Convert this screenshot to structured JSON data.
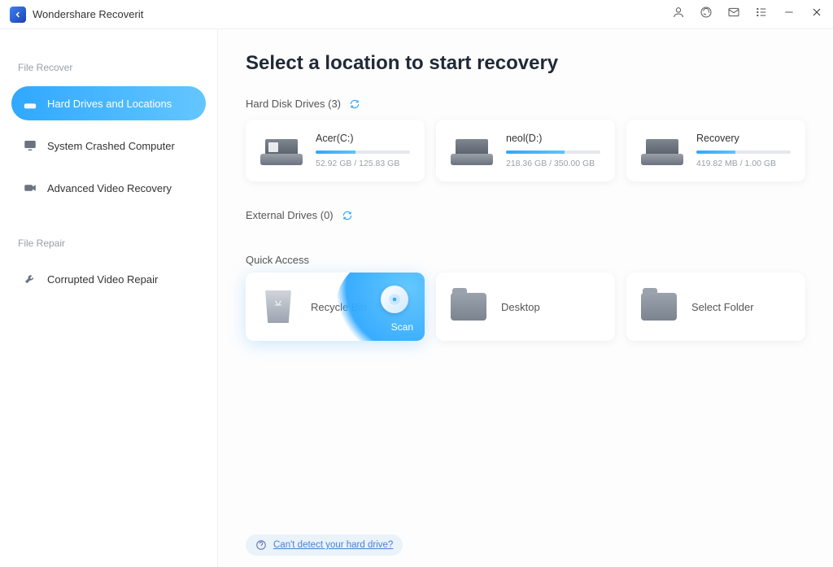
{
  "app": {
    "title": "Wondershare Recoverit"
  },
  "sidebar": {
    "sectionRecover": "File Recover",
    "sectionRepair": "File Repair",
    "items": {
      "drives": "Hard Drives and Locations",
      "crashed": "System Crashed Computer",
      "video": "Advanced Video Recovery",
      "repair": "Corrupted Video Repair"
    }
  },
  "main": {
    "title": "Select a location to start recovery",
    "hddHeader": "Hard Disk Drives (3)",
    "extHeader": "External Drives (0)",
    "quickHeader": "Quick Access"
  },
  "drives": [
    {
      "name": "Acer(C:)",
      "cap": "52.92 GB / 125.83 GB",
      "pct": 42,
      "win": true
    },
    {
      "name": "neol(D:)",
      "cap": "218.36 GB / 350.00 GB",
      "pct": 62,
      "win": false
    },
    {
      "name": "Recovery",
      "cap": "419.82 MB / 1.00 GB",
      "pct": 41,
      "win": false
    }
  ],
  "quick": {
    "recycle": "Recycle Bin",
    "desktop": "Desktop",
    "folder": "Select Folder",
    "scan": "Scan"
  },
  "help": {
    "link": "Can't detect your hard drive?"
  }
}
